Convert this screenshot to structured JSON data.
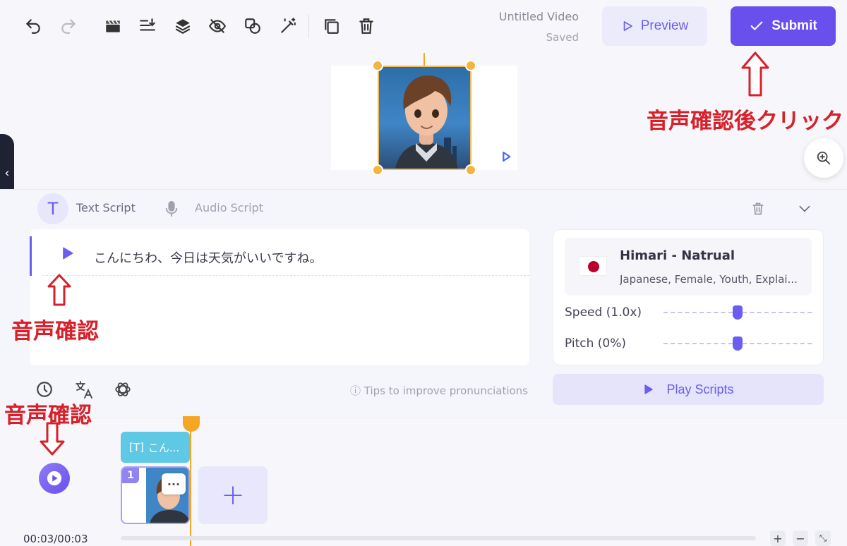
{
  "header": {
    "video_title": "Untitled Video",
    "save_status": "Saved",
    "preview_label": "Preview",
    "submit_label": "Submit"
  },
  "toolbar": {
    "icons": [
      "undo-icon",
      "redo-icon",
      "clapperboard-icon",
      "align-icon",
      "layers-icon",
      "hide-icon",
      "shapes-icon",
      "magic-wand-icon",
      "duplicate-icon",
      "delete-icon"
    ]
  },
  "annotations": {
    "submit_note": "音声確認後クリック",
    "script_play_note": "音声確認",
    "timeline_play_note": "音声確認"
  },
  "script_panel": {
    "tab_text": "Text Script",
    "tab_audio": "Audio Script",
    "script_line": "こんにちわ、今日は天気がいいですね。",
    "tips": "Tips to improve pronunciations",
    "play_scripts_label": "Play Scripts"
  },
  "voice": {
    "name": "Himari - Natrual",
    "description": "Japanese, Female, Youth, Explai...",
    "speed_label": "Speed (1.0x)",
    "pitch_label": "Pitch (0%)",
    "speed_level": 0.5,
    "pitch_level": 0.5
  },
  "timeline": {
    "text_clip_label": "こん...",
    "scene_number": "1",
    "time": "00:03/00:03"
  },
  "colors": {
    "accent": "#6a4fef",
    "annotation": "#d7202a",
    "playhead": "#f5a623"
  }
}
